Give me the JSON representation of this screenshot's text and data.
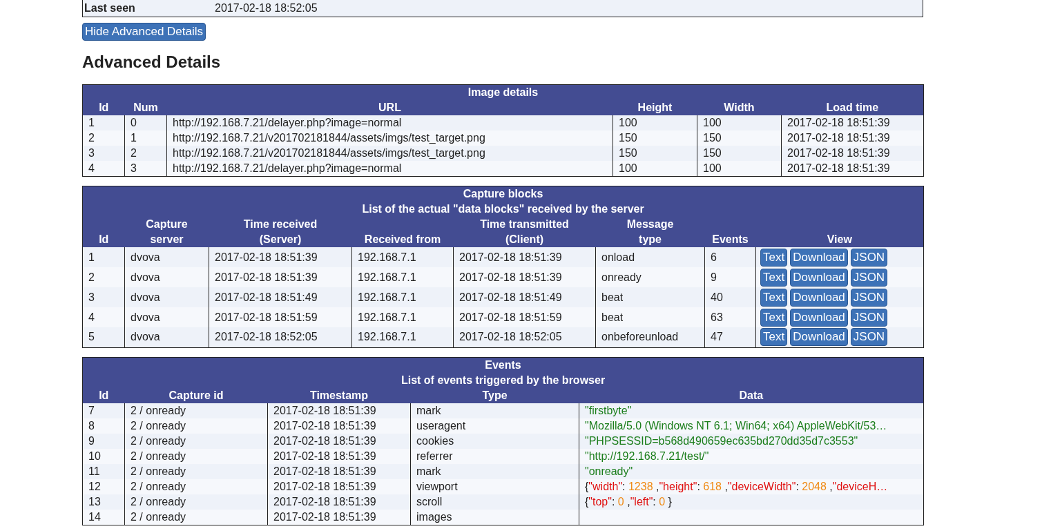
{
  "top_row": {
    "label": "Last seen",
    "value": "2017-02-18 18:52:05"
  },
  "toggle_button": "Hide Advanced Details",
  "heading": "Advanced Details",
  "image_details": {
    "title": "Image details",
    "columns": [
      "Id",
      "Num",
      "URL",
      "Height",
      "Width",
      "Load time"
    ],
    "rows": [
      [
        "1",
        "0",
        "http://192.168.7.21/delayer.php?image=normal",
        "100",
        "100",
        "2017-02-18 18:51:39"
      ],
      [
        "2",
        "1",
        "http://192.168.7.21/v201702181844/assets/imgs/test_target.png",
        "150",
        "150",
        "2017-02-18 18:51:39"
      ],
      [
        "3",
        "2",
        "http://192.168.7.21/v201702181844/assets/imgs/test_target.png",
        "150",
        "150",
        "2017-02-18 18:51:39"
      ],
      [
        "4",
        "3",
        "http://192.168.7.21/delayer.php?image=normal",
        "100",
        "100",
        "2017-02-18 18:51:39"
      ]
    ]
  },
  "capture_blocks": {
    "title": "Capture blocks",
    "subtitle": "List of the actual \"data blocks\" received by the server",
    "columns": [
      "Id",
      "Capture\nserver",
      "Time received\n(Server)",
      "Received from",
      "Time transmitted\n(Client)",
      "Message\ntype",
      "Events",
      "View"
    ],
    "rows": [
      {
        "cells": [
          "1",
          "dvova",
          "2017-02-18 18:51:39",
          "192.168.7.1",
          "2017-02-18 18:51:39",
          "onload",
          "6"
        ],
        "actions": [
          "Text",
          "Download",
          "JSON"
        ]
      },
      {
        "cells": [
          "2",
          "dvova",
          "2017-02-18 18:51:39",
          "192.168.7.1",
          "2017-02-18 18:51:39",
          "onready",
          "9"
        ],
        "actions": [
          "Text",
          "Download",
          "JSON"
        ]
      },
      {
        "cells": [
          "3",
          "dvova",
          "2017-02-18 18:51:49",
          "192.168.7.1",
          "2017-02-18 18:51:49",
          "beat",
          "40"
        ],
        "actions": [
          "Text",
          "Download",
          "JSON"
        ]
      },
      {
        "cells": [
          "4",
          "dvova",
          "2017-02-18 18:51:59",
          "192.168.7.1",
          "2017-02-18 18:51:59",
          "beat",
          "63"
        ],
        "actions": [
          "Text",
          "Download",
          "JSON"
        ]
      },
      {
        "cells": [
          "5",
          "dvova",
          "2017-02-18 18:52:05",
          "192.168.7.1",
          "2017-02-18 18:52:05",
          "onbeforeunload",
          "47"
        ],
        "actions": [
          "Text",
          "Download",
          "JSON"
        ]
      }
    ]
  },
  "events": {
    "title": "Events",
    "subtitle": "List of events triggered by the browser",
    "columns": [
      "Id",
      "Capture id",
      "Timestamp",
      "Type",
      "Data"
    ],
    "rows": [
      {
        "cells": [
          "7",
          "2 / onready",
          "2017-02-18 18:51:39",
          "mark"
        ],
        "data": [
          {
            "kind": "string",
            "text": "\"firstbyte\""
          }
        ]
      },
      {
        "cells": [
          "8",
          "2 / onready",
          "2017-02-18 18:51:39",
          "useragent"
        ],
        "data": [
          {
            "kind": "string",
            "text": "\"Mozilla/5.0 (Windows NT 6.1; Win64; x64) AppleWebKit/53…"
          }
        ]
      },
      {
        "cells": [
          "9",
          "2 / onready",
          "2017-02-18 18:51:39",
          "cookies"
        ],
        "data": [
          {
            "kind": "string",
            "text": "\"PHPSESSID=b568d490659ec635bd270dd35d7c3553\""
          }
        ]
      },
      {
        "cells": [
          "10",
          "2 / onready",
          "2017-02-18 18:51:39",
          "referrer"
        ],
        "data": [
          {
            "kind": "string",
            "text": "\"http://192.168.7.21/test/\""
          }
        ]
      },
      {
        "cells": [
          "11",
          "2 / onready",
          "2017-02-18 18:51:39",
          "mark"
        ],
        "data": [
          {
            "kind": "string",
            "text": "\"onready\""
          }
        ]
      },
      {
        "cells": [
          "12",
          "2 / onready",
          "2017-02-18 18:51:39",
          "viewport"
        ],
        "data": [
          {
            "kind": "punct",
            "text": "{"
          },
          {
            "kind": "key",
            "text": "\"width\""
          },
          {
            "kind": "punct",
            "text": ": "
          },
          {
            "kind": "number",
            "text": "1238"
          },
          {
            "kind": "punct",
            "text": " ,"
          },
          {
            "kind": "key",
            "text": "\"height\""
          },
          {
            "kind": "punct",
            "text": ": "
          },
          {
            "kind": "number",
            "text": "618"
          },
          {
            "kind": "punct",
            "text": " ,"
          },
          {
            "kind": "key",
            "text": "\"deviceWidth\""
          },
          {
            "kind": "punct",
            "text": ": "
          },
          {
            "kind": "number",
            "text": "2048"
          },
          {
            "kind": "punct",
            "text": " ,"
          },
          {
            "kind": "key",
            "text": "\"deviceH…"
          }
        ]
      },
      {
        "cells": [
          "13",
          "2 / onready",
          "2017-02-18 18:51:39",
          "scroll"
        ],
        "data": [
          {
            "kind": "punct",
            "text": "{"
          },
          {
            "kind": "key",
            "text": "\"top\""
          },
          {
            "kind": "punct",
            "text": ": "
          },
          {
            "kind": "number",
            "text": "0"
          },
          {
            "kind": "punct",
            "text": " ,"
          },
          {
            "kind": "key",
            "text": "\"left\""
          },
          {
            "kind": "punct",
            "text": ": "
          },
          {
            "kind": "number",
            "text": "0"
          },
          {
            "kind": "punct",
            "text": " }"
          }
        ]
      },
      {
        "cells": [
          "14",
          "2 / onready",
          "2017-02-18 18:51:39",
          "images"
        ]
      }
    ]
  }
}
